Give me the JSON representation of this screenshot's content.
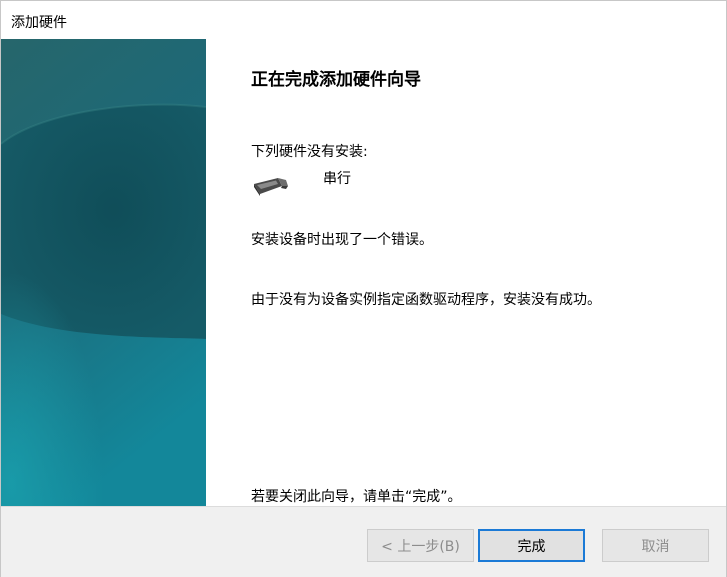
{
  "window": {
    "title": "添加硬件"
  },
  "wizard": {
    "heading": "正在完成添加硬件向导",
    "not_installed_label": "下列硬件没有安装:",
    "device": {
      "name": "串行",
      "icon": "serial-port-connector-icon"
    },
    "error_message": "安装设备时出现了一个错误。",
    "reason_message": "由于没有为设备实例指定函数驱动程序，安装没有成功。",
    "close_hint": "若要关闭此向导，请单击“完成”。"
  },
  "footer": {
    "back_label": "< 上一步(B)",
    "finish_label": "完成",
    "cancel_label": "取消"
  },
  "colors": {
    "accent": "#1b7ad6",
    "banner_top": "#1f5f67",
    "banner_bottom": "#14889a"
  }
}
